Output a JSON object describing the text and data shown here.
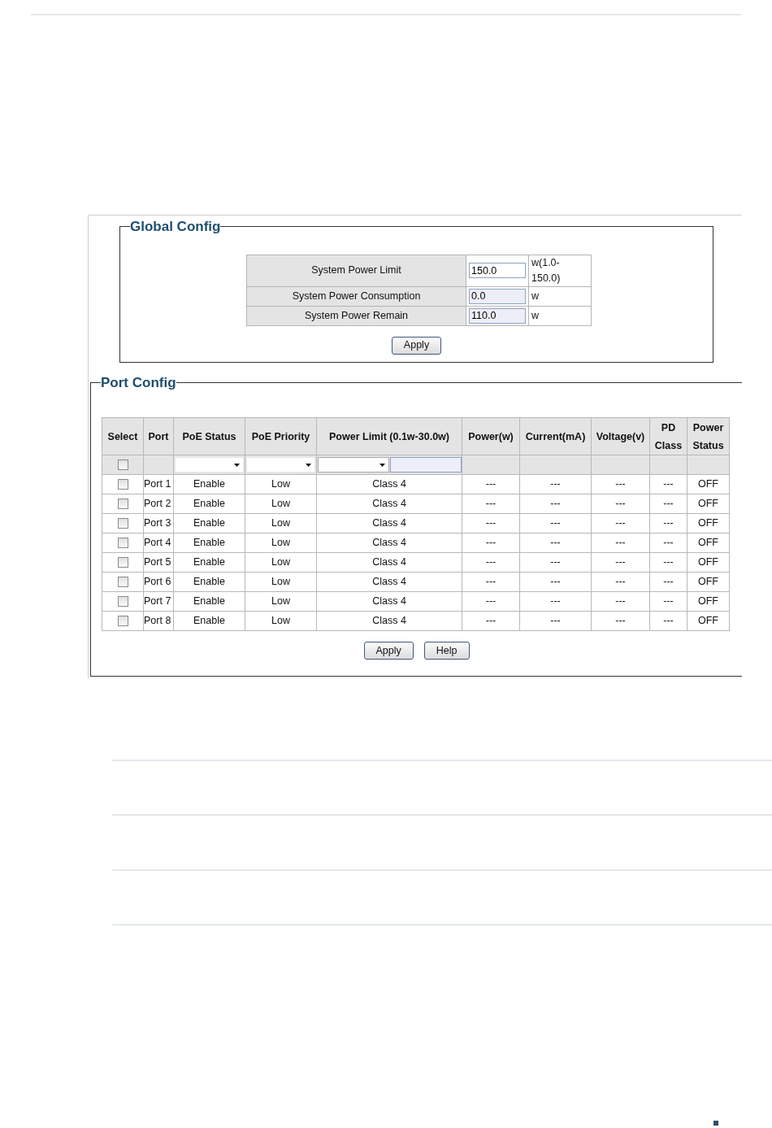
{
  "global_config": {
    "title": "Global Config",
    "fields": [
      {
        "label": "System Power Limit",
        "value": "150.0",
        "unit": "w(1.0-150.0)",
        "readonly": false
      },
      {
        "label": "System Power Consumption",
        "value": "0.0",
        "unit": "w",
        "readonly": true
      },
      {
        "label": "System Power Remain",
        "value": "110.0",
        "unit": "w",
        "readonly": true
      }
    ],
    "apply_button": "Apply"
  },
  "port_config": {
    "title": "Port Config",
    "columns": [
      "Select",
      "Port",
      "PoE Status",
      "PoE Priority",
      "Power Limit (0.1w-30.0w)",
      "Power(w)",
      "Current(mA)",
      "Voltage(v)",
      "PD Class",
      "Power Status"
    ],
    "select_all": {
      "checked": false
    },
    "rows": [
      {
        "selected": false,
        "port": "Port 1",
        "poe_status": "Enable",
        "poe_priority": "Low",
        "power_limit": "Class 4",
        "power": "---",
        "current": "---",
        "voltage": "---",
        "pd_class": "---",
        "power_status": "OFF"
      },
      {
        "selected": false,
        "port": "Port 2",
        "poe_status": "Enable",
        "poe_priority": "Low",
        "power_limit": "Class 4",
        "power": "---",
        "current": "---",
        "voltage": "---",
        "pd_class": "---",
        "power_status": "OFF"
      },
      {
        "selected": false,
        "port": "Port 3",
        "poe_status": "Enable",
        "poe_priority": "Low",
        "power_limit": "Class 4",
        "power": "---",
        "current": "---",
        "voltage": "---",
        "pd_class": "---",
        "power_status": "OFF"
      },
      {
        "selected": false,
        "port": "Port 4",
        "poe_status": "Enable",
        "poe_priority": "Low",
        "power_limit": "Class 4",
        "power": "---",
        "current": "---",
        "voltage": "---",
        "pd_class": "---",
        "power_status": "OFF"
      },
      {
        "selected": false,
        "port": "Port 5",
        "poe_status": "Enable",
        "poe_priority": "Low",
        "power_limit": "Class 4",
        "power": "---",
        "current": "---",
        "voltage": "---",
        "pd_class": "---",
        "power_status": "OFF"
      },
      {
        "selected": false,
        "port": "Port 6",
        "poe_status": "Enable",
        "poe_priority": "Low",
        "power_limit": "Class 4",
        "power": "---",
        "current": "---",
        "voltage": "---",
        "pd_class": "---",
        "power_status": "OFF"
      },
      {
        "selected": false,
        "port": "Port 7",
        "poe_status": "Enable",
        "poe_priority": "Low",
        "power_limit": "Class 4",
        "power": "---",
        "current": "---",
        "voltage": "---",
        "pd_class": "---",
        "power_status": "OFF"
      },
      {
        "selected": false,
        "port": "Port 8",
        "poe_status": "Enable",
        "poe_priority": "Low",
        "power_limit": "Class 4",
        "power": "---",
        "current": "---",
        "voltage": "---",
        "pd_class": "---",
        "power_status": "OFF"
      }
    ],
    "buttons": [
      "Apply",
      "Help"
    ]
  }
}
